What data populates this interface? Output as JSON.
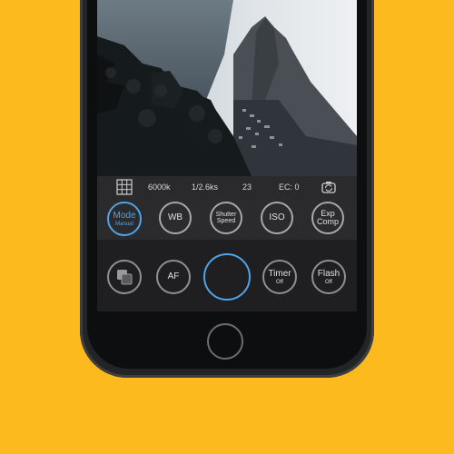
{
  "status": {
    "white_balance": "6000k",
    "shutter": "1/2.6ks",
    "iso_value": "23",
    "exposure_comp": "EC: 0"
  },
  "controls": {
    "mode": {
      "label": "Mode",
      "sub": "Manual"
    },
    "wb": {
      "label": "WB"
    },
    "shutter_speed": {
      "line1": "Shutter",
      "line2": "Speed"
    },
    "iso": {
      "label": "ISO"
    },
    "exp_comp": {
      "line1": "Exp",
      "line2": "Comp"
    }
  },
  "actions": {
    "af": {
      "label": "AF"
    },
    "timer": {
      "label": "Timer",
      "sub": "Off"
    },
    "flash": {
      "label": "Flash",
      "sub": "Off"
    }
  },
  "colors": {
    "background": "#FDBA1E",
    "accent": "#4FA3E8",
    "phone_body": "#222426"
  },
  "icons": {
    "grid": "grid-icon",
    "rotate": "rotate-camera-icon",
    "layers": "layers-icon"
  }
}
